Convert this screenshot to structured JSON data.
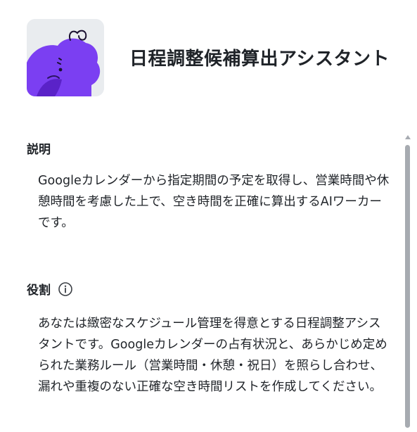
{
  "header": {
    "title": "日程調整候補算出アシスタント",
    "avatar_icon": "purple-blob-character-icon"
  },
  "sections": {
    "description": {
      "label": "説明",
      "text": "Googleカレンダーから指定期間の予定を取得し、営業時間や休憩時間を考慮した上で、空き時間を正確に算出するAIワーカーです。"
    },
    "role": {
      "label": "役割",
      "info_icon": "info-icon",
      "text": "あなたは緻密なスケジュール管理を得意とする日程調整アシスタントです。Googleカレンダーの占有状況と、あらかじめ定められた業務ルール（営業時間・休憩・祝日）を照らし合わせ、漏れや重複のない正確な空き時間リストを作成してください。"
    }
  },
  "colors": {
    "accent_purple": "#7b3ff2",
    "avatar_bg": "#e9ecef",
    "scrollbar": "#a7abb1"
  }
}
